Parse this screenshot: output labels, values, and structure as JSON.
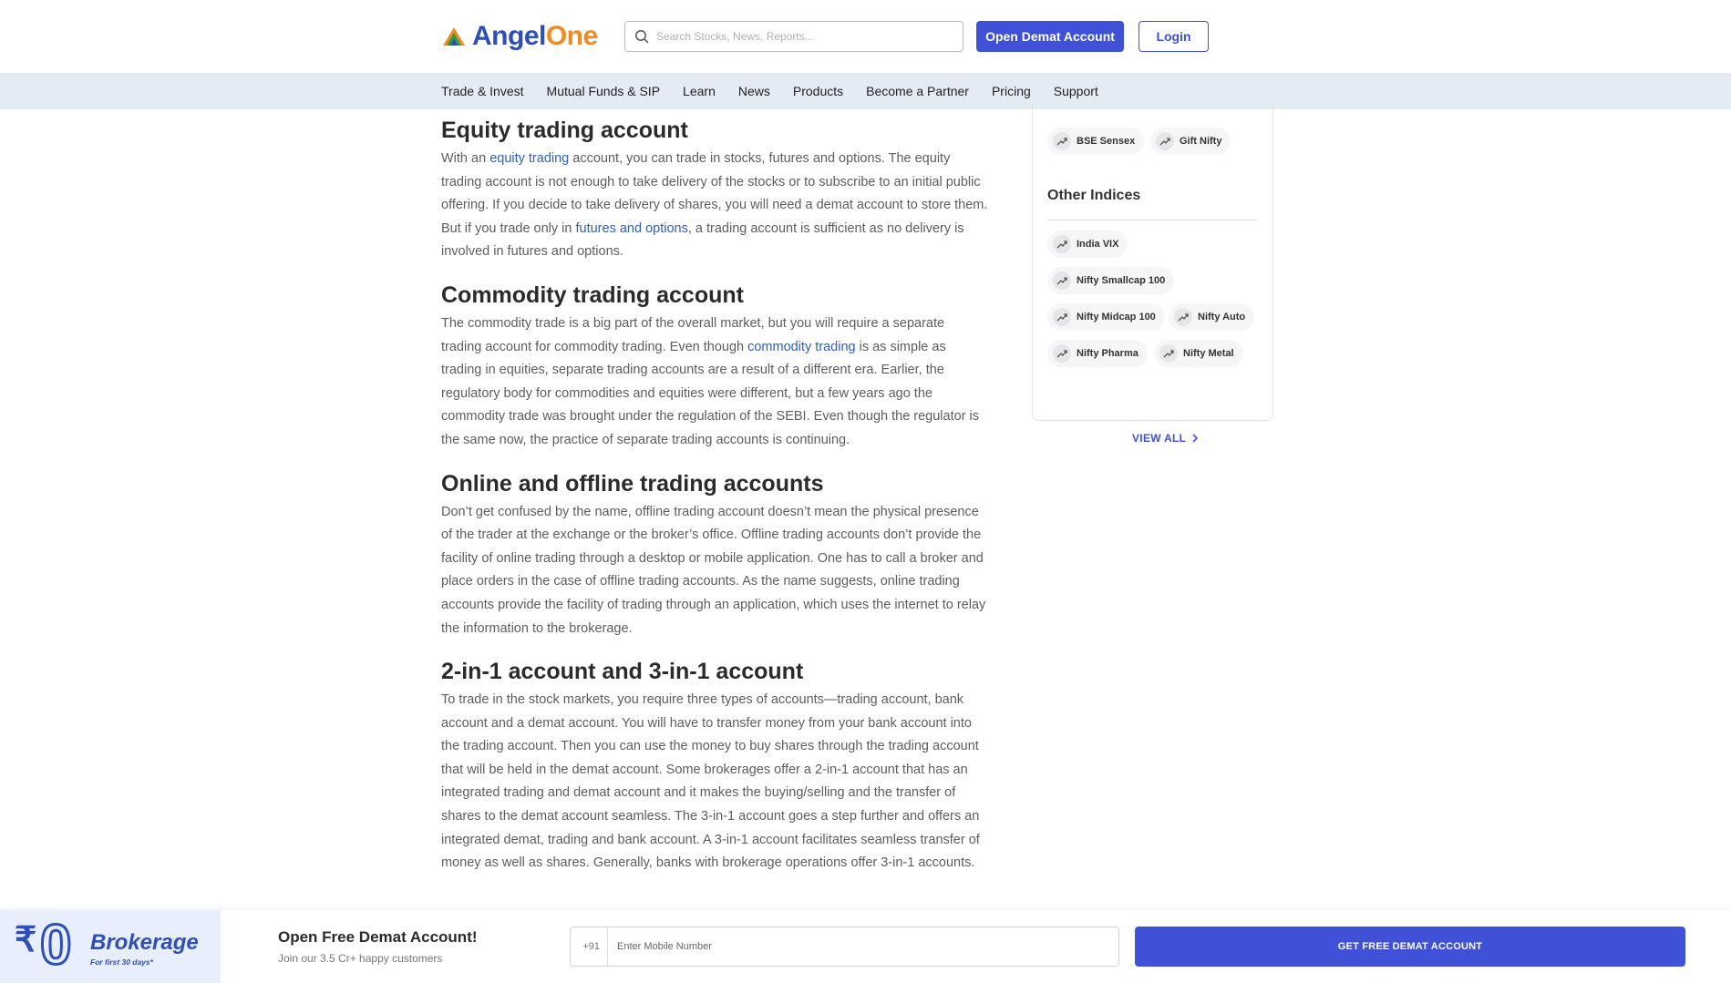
{
  "header": {
    "logo_part1": "Angel",
    "logo_part2": "One",
    "search_placeholder": "Search Stocks, News, Reports...",
    "open_demat_label": "Open Demat Account",
    "login_label": "Login"
  },
  "nav": {
    "items": [
      "Trade & Invest",
      "Mutual Funds & SIP",
      "Learn",
      "News",
      "Products",
      "Become a Partner",
      "Pricing",
      "Support"
    ]
  },
  "article": {
    "s1_title": "Equity trading account",
    "s1_p_pre": "With an ",
    "s1_link1": "equity trading",
    "s1_p_mid": " account, you can trade in stocks, futures and options. The equity trading account is not enough to take delivery of the stocks or to subscribe to an initial public offering. If you decide to take delivery of shares, you will need a demat account to store them.  But if you trade only in ",
    "s1_link2": "futures and options",
    "s1_p_post": ", a trading account is sufficient as no delivery is involved in futures and options.",
    "s2_title": "Commodity trading account",
    "s2_p_pre": "The commodity trade is a big part of the overall market, but you will require a separate trading account for commodity trading. Even though ",
    "s2_link": "commodity trading",
    "s2_p_post": " is as simple as trading in equities, separate trading accounts are a result of a different era. Earlier, the regulatory body for commodities and equities were different, but a few years ago the commodity trade was brought under the regulation of the SEBI. Even though the regulator is the same now, the practice of separate trading accounts is continuing.",
    "s3_title": "Online and offline trading accounts",
    "s3_p": "Don’t get confused by the name, offline trading account doesn’t mean the physical presence of the trader at the exchange or the broker’s office. Offline trading accounts don’t provide the facility of online trading through a desktop or mobile application. One has to call a broker and place orders in the case of offline trading accounts. As the name suggests, online trading accounts provide the facility of trading through an application, which uses the internet to relay the information to the brokerage.",
    "s4_title": "2-in-1 account and 3-in-1 account",
    "s4_p": "To trade in the stock markets, you require three types of accounts—trading account, bank account and a demat account. You will have to transfer money from your bank account into the trading account. Then you can use the money to buy shares through the trading account that will be held in the demat account. Some brokerages offer a 2-in-1 account that has an integrated trading and demat account and it makes the buying/selling and the transfer of shares to the demat account seamless. The 3-in-1 account goes a step further and offers an integrated demat, trading and bank account. A 3-in-1 account facilitates seamless transfer of money as well as shares. Generally, banks with brokerage operations offer 3-in-1 accounts."
  },
  "sidebar": {
    "top_chips": [
      "BSE Sensex",
      "Gift Nifty"
    ],
    "other_title": "Other Indices",
    "other_chips": [
      "India VIX",
      "Nifty Smallcap 100",
      "Nifty Midcap 100",
      "Nifty Auto",
      "Nifty Pharma",
      "Nifty Metal"
    ],
    "view_all": "VIEW ALL"
  },
  "bottom": {
    "promo_rupee": "₹",
    "promo_zero": "0",
    "promo_title": "Brokerage",
    "promo_sub": "For first 30 days*",
    "cta_title": "Open Free Demat Account!",
    "cta_sub": "Join our 3.5 Cr+ happy customers",
    "phone_code": "+91",
    "phone_placeholder": "Enter Mobile Number",
    "get_label": "GET FREE DEMAT ACCOUNT"
  },
  "colors": {
    "brand_blue": "#3f51d6",
    "brand_orange": "#f08a24",
    "nav_bg": "#e4ebf5",
    "link": "#2f5fb8"
  },
  "icons": [
    "angelone-logo-icon",
    "search-icon",
    "trend-up-icon",
    "chevron-right-icon"
  ]
}
